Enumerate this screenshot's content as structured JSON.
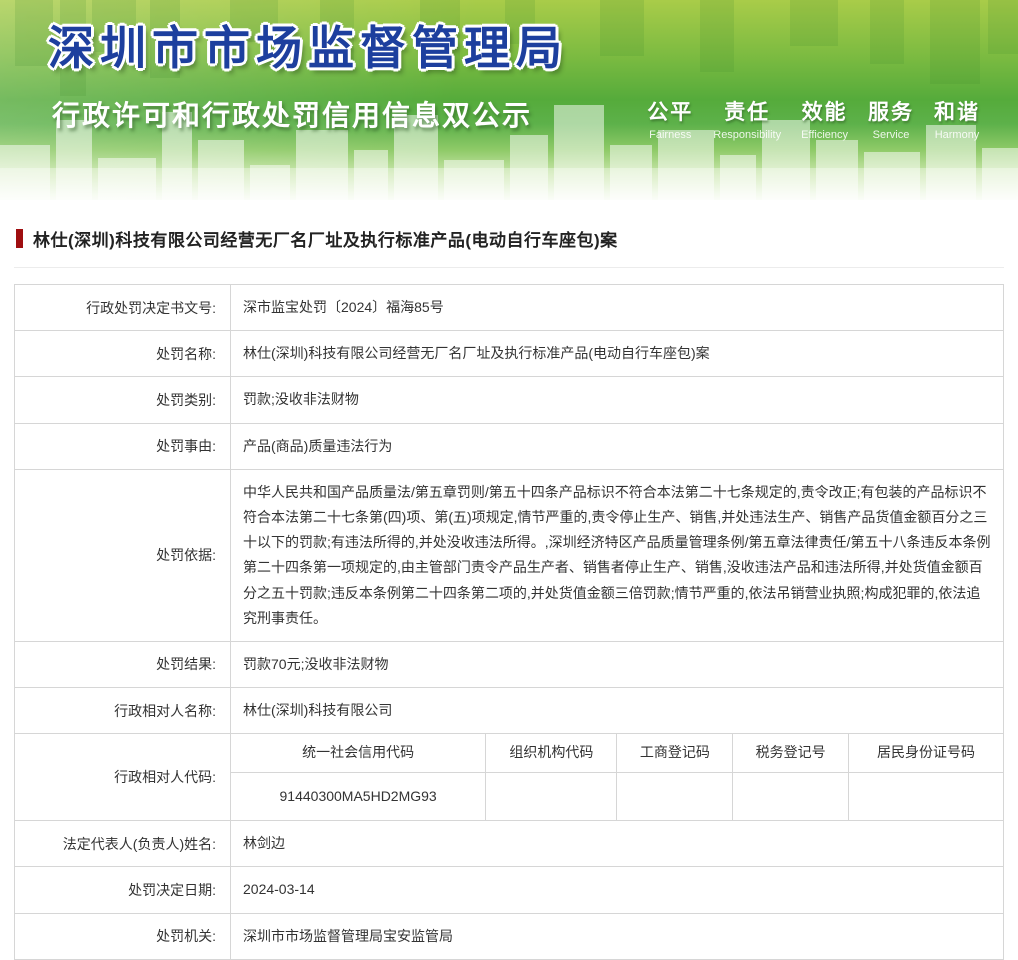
{
  "header": {
    "title": "深圳市市场监督管理局",
    "subtitle": "行政许可和行政处罚信用信息双公示",
    "values": [
      {
        "cn": "公平",
        "en": "Fairness"
      },
      {
        "cn": "责任",
        "en": "Responsibility"
      },
      {
        "cn": "效能",
        "en": "Efficiency"
      },
      {
        "cn": "服务",
        "en": "Service"
      },
      {
        "cn": "和谐",
        "en": "Harmony"
      }
    ]
  },
  "case": {
    "title": "林仕(深圳)科技有限公司经营无厂名厂址及执行标准产品(电动自行车座包)案"
  },
  "table": {
    "rows": [
      {
        "label": "行政处罚决定书文号:",
        "value": "深市监宝处罚〔2024〕福海85号"
      },
      {
        "label": "处罚名称:",
        "value": "林仕(深圳)科技有限公司经营无厂名厂址及执行标准产品(电动自行车座包)案"
      },
      {
        "label": "处罚类别:",
        "value": "罚款;没收非法财物"
      },
      {
        "label": "处罚事由:",
        "value": "产品(商品)质量违法行为"
      },
      {
        "label": "处罚依据:",
        "value": "中华人民共和国产品质量法/第五章罚则/第五十四条产品标识不符合本法第二十七条规定的,责令改正;有包装的产品标识不符合本法第二十七条第(四)项、第(五)项规定,情节严重的,责令停止生产、销售,并处违法生产、销售产品货值金额百分之三十以下的罚款;有违法所得的,并处没收违法所得。,深圳经济特区产品质量管理条例/第五章法律责任/第五十八条违反本条例第二十四条第一项规定的,由主管部门责令产品生产者、销售者停止生产、销售,没收违法产品和违法所得,并处货值金额百分之五十罚款;违反本条例第二十四条第二项的,并处货值金额三倍罚款;情节严重的,依法吊销营业执照;构成犯罪的,依法追究刑事责任。"
      },
      {
        "label": "处罚结果:",
        "value": "罚款70元;没收非法财物"
      },
      {
        "label": "行政相对人名称:",
        "value": "林仕(深圳)科技有限公司"
      },
      {
        "label": "行政相对人代码:",
        "value": ""
      },
      {
        "label": "法定代表人(负责人)姓名:",
        "value": "林剑边"
      },
      {
        "label": "处罚决定日期:",
        "value": "2024-03-14"
      },
      {
        "label": "处罚机关:",
        "value": "深圳市市场监督管理局宝安监管局"
      }
    ],
    "code_table": {
      "headers": [
        "统一社会信用代码",
        "组织机构代码",
        "工商登记码",
        "税务登记号",
        "居民身份证号码"
      ],
      "values": [
        "91440300MA5HD2MG93",
        "",
        "",
        "",
        ""
      ]
    }
  },
  "colors": {
    "accent_red": "#9f0e10",
    "title_blue": "#1d3f9e",
    "banner_green": "#55ab3b"
  }
}
